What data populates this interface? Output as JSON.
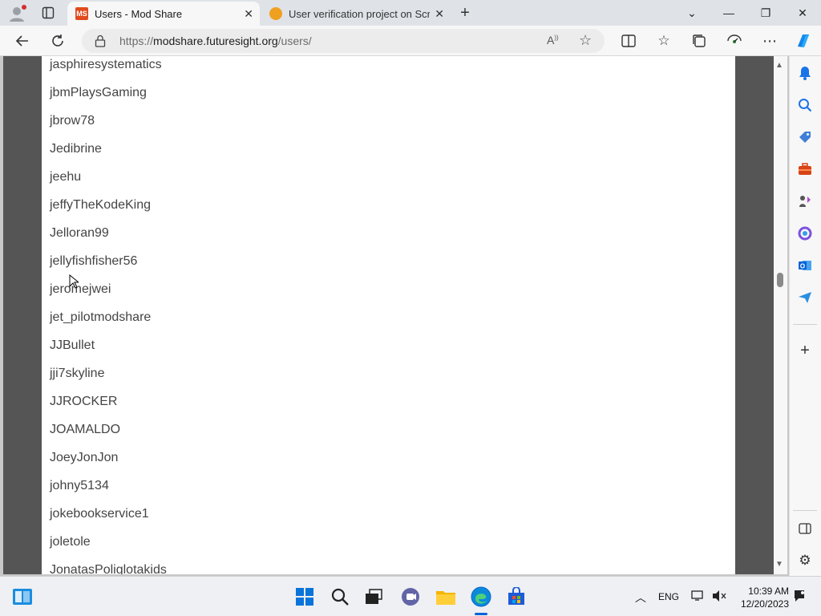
{
  "browser": {
    "tabs": [
      {
        "label": "Users - Mod Share",
        "favicon_text": "MS",
        "active": true
      },
      {
        "label": "User verification project on Scrat",
        "favicon_text": "",
        "active": false
      }
    ],
    "url": {
      "prefix": "https://",
      "host": "modshare.futuresight.org",
      "path": "/users/"
    }
  },
  "page": {
    "users": [
      "jasphiresystematics",
      "jbmPlaysGaming",
      "jbrow78",
      "Jedibrine",
      "jeehu",
      "jeffyTheKodeKing",
      "Jelloran99",
      "jellyfishfisher56",
      "jeromejwei",
      "jet_pilotmodshare",
      "JJBullet",
      "jji7skyline",
      "JJROCKER",
      "JOAMALDO",
      "JoeyJonJon",
      "johny5134",
      "jokebookservice1",
      "joletole",
      "JonatasPoliglotakids"
    ]
  },
  "taskbar": {
    "language": "ENG",
    "time": "10:39 AM",
    "date": "12/20/2023"
  },
  "colors": {
    "accent": "#0a64d6",
    "ms_favicon": "#e04a1c",
    "band": "#555555"
  }
}
